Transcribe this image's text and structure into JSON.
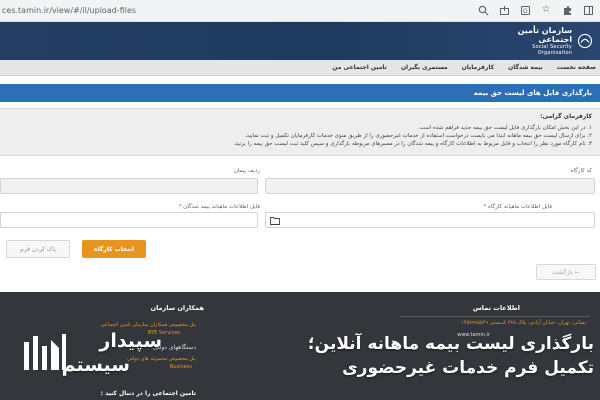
{
  "browser": {
    "url": "ces.tamin.ir/view/#/il/upload-files",
    "icons": [
      "zoom-icon",
      "share-icon",
      "extension-icon",
      "bookmark-star-icon",
      "puzzle-icon",
      "sidebar-icon"
    ]
  },
  "header": {
    "logo_fa": "سازمان تأمین اجتماعی",
    "logo_en": "Social Security Organization"
  },
  "nav": {
    "items": [
      "صفحه نخست",
      "بیمه شدگان",
      "کارفرمایان",
      "مستمری بگیران",
      "تامین اجتماعی من"
    ]
  },
  "page": {
    "title": "بارگذاری فایل های لیست حق بیمه"
  },
  "notice": {
    "title": "کارفرمای گرامی:",
    "lines": [
      "۱. در این بخش امکان بارگذاری فایل لیست حق بیمه جدید فراهم شده است.",
      "۲. برای ارسال لیست حق بیمه ماهانه ابتدا می بایست درخواست استفاده از خدمات غیرحضوری را از طریق منوی خدمات کارفرمایان تکمیل و ثبت نمایید.",
      "۳. نام کارگاه مورد نظر را انتخاب و فایل مربوط به اطلاعات کارگاه و بیمه شدگان را در مسیرهای مربوطه بارگذاری و سپس کلید ثبت لیست حق بیمه را بزنید."
    ]
  },
  "form": {
    "workshop_code_label": "کد کارگاه",
    "contract_row_label": "ردیف پیمان",
    "workshop_file_label": "فایل اطلاعات ماهیانه کارگاه *",
    "insured_file_label": "فایل اطلاعات ماهیانه بیمه شدگان *",
    "select_workshop_btn": "انتخاب کارگاه",
    "clear_form_btn": "پاک کردن فرم",
    "back_btn": "بازگشت ←"
  },
  "footer": {
    "contact_heading": "اطلاعات تماس",
    "address": "نشانی: تهران، خیابان آزادی، پلاک ۳۶۵ کدپستی ۱۴۵۷۹۹۵۵۴۹",
    "website": "www.tamin.ir",
    "partners_heading": "همکاران سازمان",
    "partner_1": "پنل مخصوص همکاران سازمان تامین اجتماعی",
    "partner_1_en": "BYE Services",
    "partner_2": "دستگاههای دولتی",
    "partner_3": "پنل مخصوص مجموعه های دولتی",
    "partner_3_en": "Business",
    "follow_heading": "تامین اجتماعی را در دنبال کنید :"
  },
  "overlay": {
    "headline_1": "بارگذاری لیست بیمه ماهانه آنلاین؛",
    "headline_2": "تکمیل فرم خدمات غیرحضوری",
    "brand_1": "سپیدار",
    "brand_2": "سیستم"
  },
  "colors": {
    "header": "#1e3a5f",
    "title_bar": "#2d6fb4",
    "button_orange": "#e8951f",
    "footer": "#33373b"
  }
}
